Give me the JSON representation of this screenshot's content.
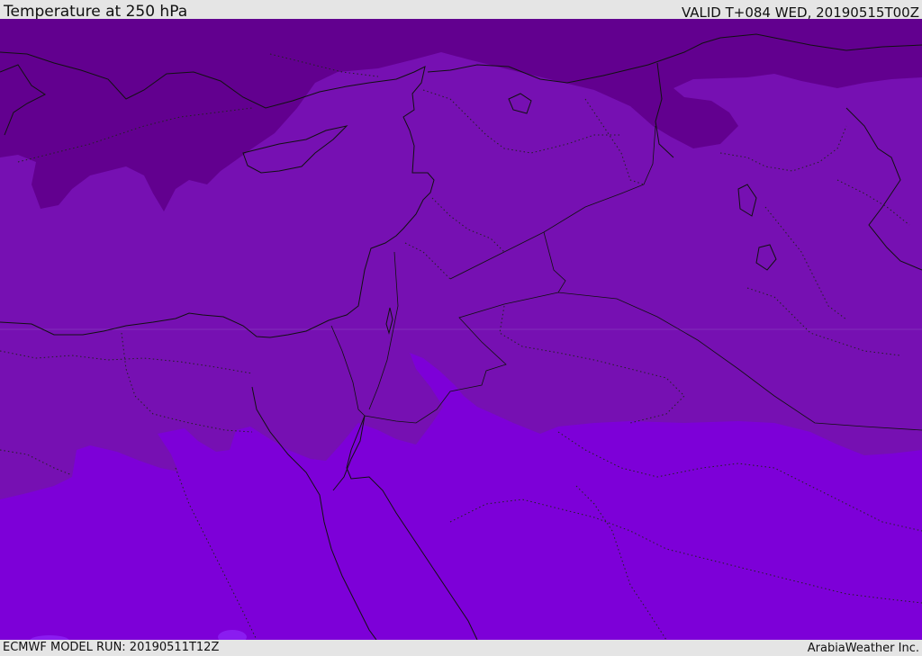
{
  "header": {
    "title": "Temperature at 250 hPa",
    "valid_time": "VALID T+084 WED, 20190515T00Z"
  },
  "footer": {
    "model_run": "ECMWF MODEL RUN: 20190511T12Z",
    "credit": "ArabiaWeather Inc."
  },
  "colors": {
    "band_coldest": "#62008f",
    "band_cold": "#7610b2",
    "band_warm": "#7d00d8",
    "band_warmest": "#8a1cf0",
    "lines": "#111111"
  }
}
